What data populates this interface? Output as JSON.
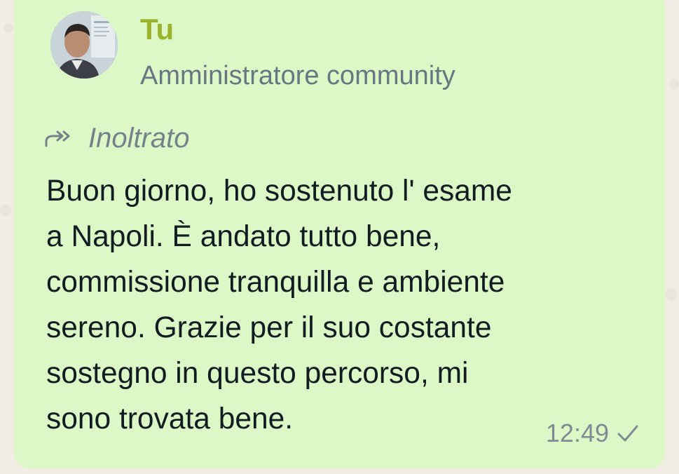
{
  "message": {
    "sender_name": "Tu",
    "sender_role": "Amministratore community",
    "forwarded_label": "Inoltrato",
    "forwarded_icon": "forward-arrow-icon",
    "lines": [
      "Buon giorno, ho sostenuto l' esame",
      "a Napoli. È andato tutto bene,",
      "commissione tranquilla e ambiente",
      "sereno. Grazie per il suo costante",
      "sostegno in questo percorso, mi",
      "sono trovata bene."
    ],
    "time": "12:49",
    "status_icon": "single-check-icon"
  },
  "colors": {
    "bubble": "#dcf8c6",
    "sender_name": "#9bb32d",
    "secondary_text": "#667781",
    "message_text": "#111b21"
  }
}
